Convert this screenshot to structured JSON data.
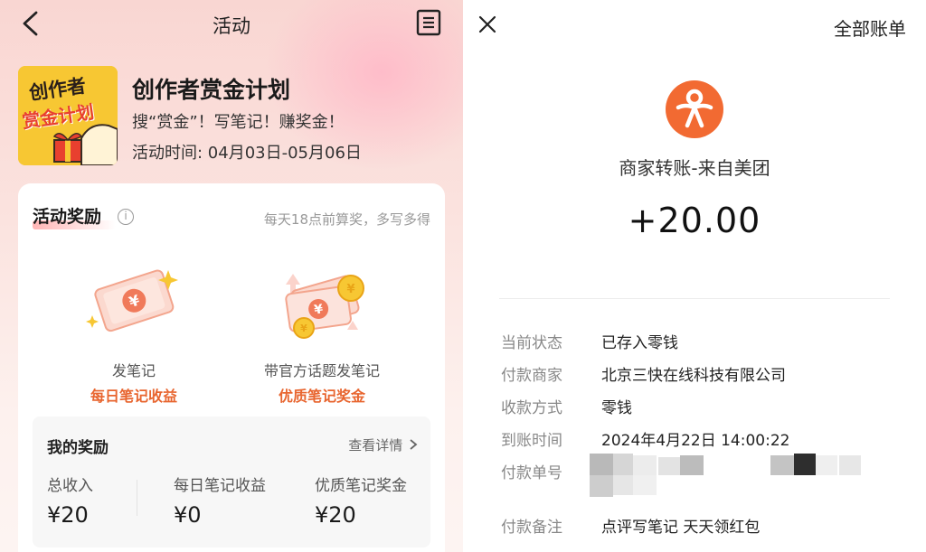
{
  "left": {
    "header": {
      "title": "活动"
    },
    "activity": {
      "title": "创作者赏金计划",
      "subtitle": "搜“赏金”！写笔记！赚奖金！",
      "time": "活动时间: 04月03日-05月06日",
      "banner_text_top": "创作者",
      "banner_text_bottom": "赏金计划"
    },
    "rewards_section": {
      "title": "活动奖励",
      "note": "每天18点前算奖，多写多得",
      "items": [
        {
          "label": "发笔记",
          "value": "每日笔记收益"
        },
        {
          "label": "带官方话题发笔记",
          "value": "优质笔记奖金"
        }
      ]
    },
    "my_rewards": {
      "title": "我的奖励",
      "link": "查看详情",
      "stats": [
        {
          "label": "总收入",
          "value": "¥20"
        },
        {
          "label": "每日笔记收益",
          "value": "¥0"
        },
        {
          "label": "优质笔记奖金",
          "value": "¥20"
        }
      ]
    }
  },
  "right": {
    "header": {
      "all_bills": "全部账单"
    },
    "merchant_line": "商家转账-来自美团",
    "amount": "+20.00",
    "details": [
      {
        "key": "当前状态",
        "value": "已存入零钱"
      },
      {
        "key": "付款商家",
        "value": "北京三快在线科技有限公司"
      },
      {
        "key": "收款方式",
        "value": "零钱"
      },
      {
        "key": "到账时间",
        "value": "2024年4月22日 14:00:22"
      },
      {
        "key": "付款单号",
        "value": ""
      },
      {
        "key": "付款备注",
        "value": "点评写笔记 天天领红包"
      }
    ],
    "colors": {
      "logo": "#f26a32",
      "accent": "#e8652f"
    }
  }
}
